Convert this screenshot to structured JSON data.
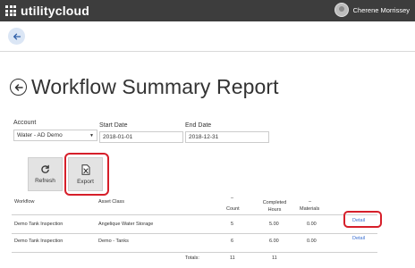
{
  "app": {
    "brand": "utilitycloud",
    "user_name": "Cherene Morrissey"
  },
  "page": {
    "title": "Workflow Summary Report"
  },
  "filters": {
    "account_label": "Account",
    "account_value": "Water - AD Demo",
    "start_date_label": "Start Date",
    "start_date_value": "2018-01-01",
    "end_date_label": "End Date",
    "end_date_value": "2018-12-31"
  },
  "toolbar": {
    "refresh_label": "Refresh",
    "export_label": "Export"
  },
  "table": {
    "headers": {
      "workflow": "Workflow",
      "asset_class": "Asset Class",
      "count": "Count",
      "count_sort": "–",
      "completed_hours": "Completed Hours",
      "materials": "Materials",
      "materials_sort": "–"
    },
    "rows": [
      {
        "workflow": "Demo Tank Inspection",
        "asset_class": "Angelique Water Storage",
        "count": "5",
        "completed_hours": "5.00",
        "materials": "0.00",
        "action": "Detail"
      },
      {
        "workflow": "Demo Tank Inspection",
        "asset_class": "Demo - Tanks",
        "count": "6",
        "completed_hours": "6.00",
        "materials": "0.00",
        "action": "Detail"
      }
    ],
    "totals_label": "Totals:",
    "total_count": "11",
    "total_hours": "11"
  },
  "colors": {
    "topbar": "#3d3d3d",
    "highlight": "#d61f2a",
    "link": "#3a6fd1"
  }
}
